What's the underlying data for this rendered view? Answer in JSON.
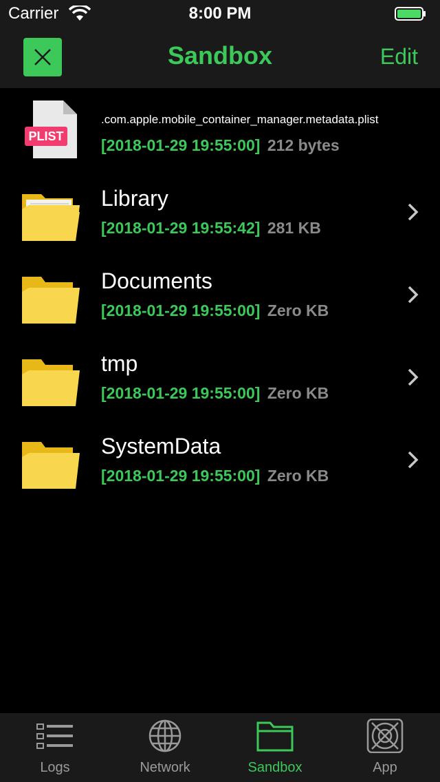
{
  "status_bar": {
    "carrier": "Carrier",
    "time": "8:00 PM",
    "wifi_icon": "wifi-icon",
    "battery_icon": "battery-icon"
  },
  "nav": {
    "title": "Sandbox",
    "edit_label": "Edit",
    "close_icon": "close-icon"
  },
  "colors": {
    "accent": "#3cc95a",
    "background": "#000000",
    "bar_background": "#1a1a1a",
    "secondary_text": "#8a8a8a",
    "folder_yellow": "#f5c518"
  },
  "files": [
    {
      "name": ".com.apple.mobile_container_manager.metadata.plist",
      "date": "[2018-01-29 19:55:00]",
      "size": "212 bytes",
      "icon": "plist-file-icon",
      "badge": "PLIST"
    },
    {
      "name": "Library",
      "date": "[2018-01-29 19:55:42]",
      "size": "281 KB",
      "icon": "folder-with-files-icon"
    },
    {
      "name": "Documents",
      "date": "[2018-01-29 19:55:00]",
      "size": "Zero KB",
      "icon": "folder-icon"
    },
    {
      "name": "tmp",
      "date": "[2018-01-29 19:55:00]",
      "size": "Zero KB",
      "icon": "folder-icon"
    },
    {
      "name": "SystemData",
      "date": "[2018-01-29 19:55:00]",
      "size": "Zero KB",
      "icon": "folder-icon"
    }
  ],
  "tabs": [
    {
      "label": "Logs",
      "icon": "list-icon",
      "active": false
    },
    {
      "label": "Network",
      "icon": "globe-icon",
      "active": false
    },
    {
      "label": "Sandbox",
      "icon": "folder-outline-icon",
      "active": true
    },
    {
      "label": "App",
      "icon": "app-icon",
      "active": false
    }
  ]
}
